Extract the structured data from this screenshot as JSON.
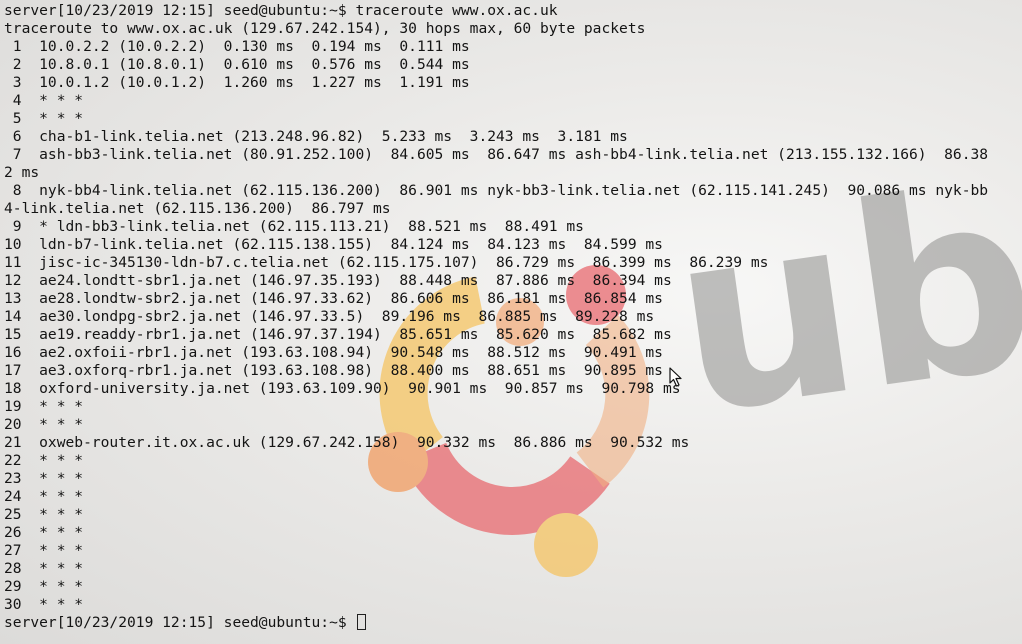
{
  "terminal": {
    "lines": [
      "server[10/23/2019 12:15] seed@ubuntu:~$ traceroute www.ox.ac.uk",
      "traceroute to www.ox.ac.uk (129.67.242.154), 30 hops max, 60 byte packets",
      " 1  10.0.2.2 (10.0.2.2)  0.130 ms  0.194 ms  0.111 ms",
      " 2  10.8.0.1 (10.8.0.1)  0.610 ms  0.576 ms  0.544 ms",
      " 3  10.0.1.2 (10.0.1.2)  1.260 ms  1.227 ms  1.191 ms",
      " 4  * * *",
      " 5  * * *",
      " 6  cha-b1-link.telia.net (213.248.96.82)  5.233 ms  3.243 ms  3.181 ms",
      " 7  ash-bb3-link.telia.net (80.91.252.100)  84.605 ms  86.647 ms ash-bb4-link.telia.net (213.155.132.166)  86.38",
      "2 ms",
      " 8  nyk-bb4-link.telia.net (62.115.136.200)  86.901 ms nyk-bb3-link.telia.net (62.115.141.245)  90.086 ms nyk-bb",
      "4-link.telia.net (62.115.136.200)  86.797 ms",
      " 9  * ldn-bb3-link.telia.net (62.115.113.21)  88.521 ms  88.491 ms",
      "10  ldn-b7-link.telia.net (62.115.138.155)  84.124 ms  84.123 ms  84.599 ms",
      "11  jisc-ic-345130-ldn-b7.c.telia.net (62.115.175.107)  86.729 ms  86.399 ms  86.239 ms",
      "12  ae24.londtt-sbr1.ja.net (146.97.35.193)  88.448 ms  87.886 ms  86.394 ms",
      "13  ae28.londtw-sbr2.ja.net (146.97.33.62)  86.606 ms  86.181 ms  86.854 ms",
      "14  ae30.londpg-sbr2.ja.net (146.97.33.5)  89.196 ms  86.885 ms  89.228 ms",
      "15  ae19.readdy-rbr1.ja.net (146.97.37.194)  85.651 ms  85.620 ms  85.682 ms",
      "16  ae2.oxfoii-rbr1.ja.net (193.63.108.94)  90.548 ms  88.512 ms  90.491 ms",
      "17  ae3.oxforq-rbr1.ja.net (193.63.108.98)  88.400 ms  88.651 ms  90.895 ms",
      "18  oxford-university.ja.net (193.63.109.90)  90.901 ms  90.857 ms  90.798 ms",
      "19  * * *",
      "20  * * *",
      "21  oxweb-router.it.ox.ac.uk (129.67.242.158)  90.332 ms  86.886 ms  90.532 ms",
      "22  * * *",
      "23  * * *",
      "24  * * *",
      "25  * * *",
      "26  * * *",
      "27  * * *",
      "28  * * *",
      "29  * * *",
      "30  * * *"
    ],
    "prompt": "server[10/23/2019 12:15] seed@ubuntu:~$ "
  },
  "wallpaper": {
    "logo_text": "ubu",
    "colors": {
      "orange": "#f29a5c",
      "red": "#e8656b",
      "yellow": "#f6c35e",
      "gray": "#9c9c9a"
    }
  },
  "icons": {
    "mouse": "arrow-pointer-icon",
    "cursor": "text-cursor-block"
  }
}
